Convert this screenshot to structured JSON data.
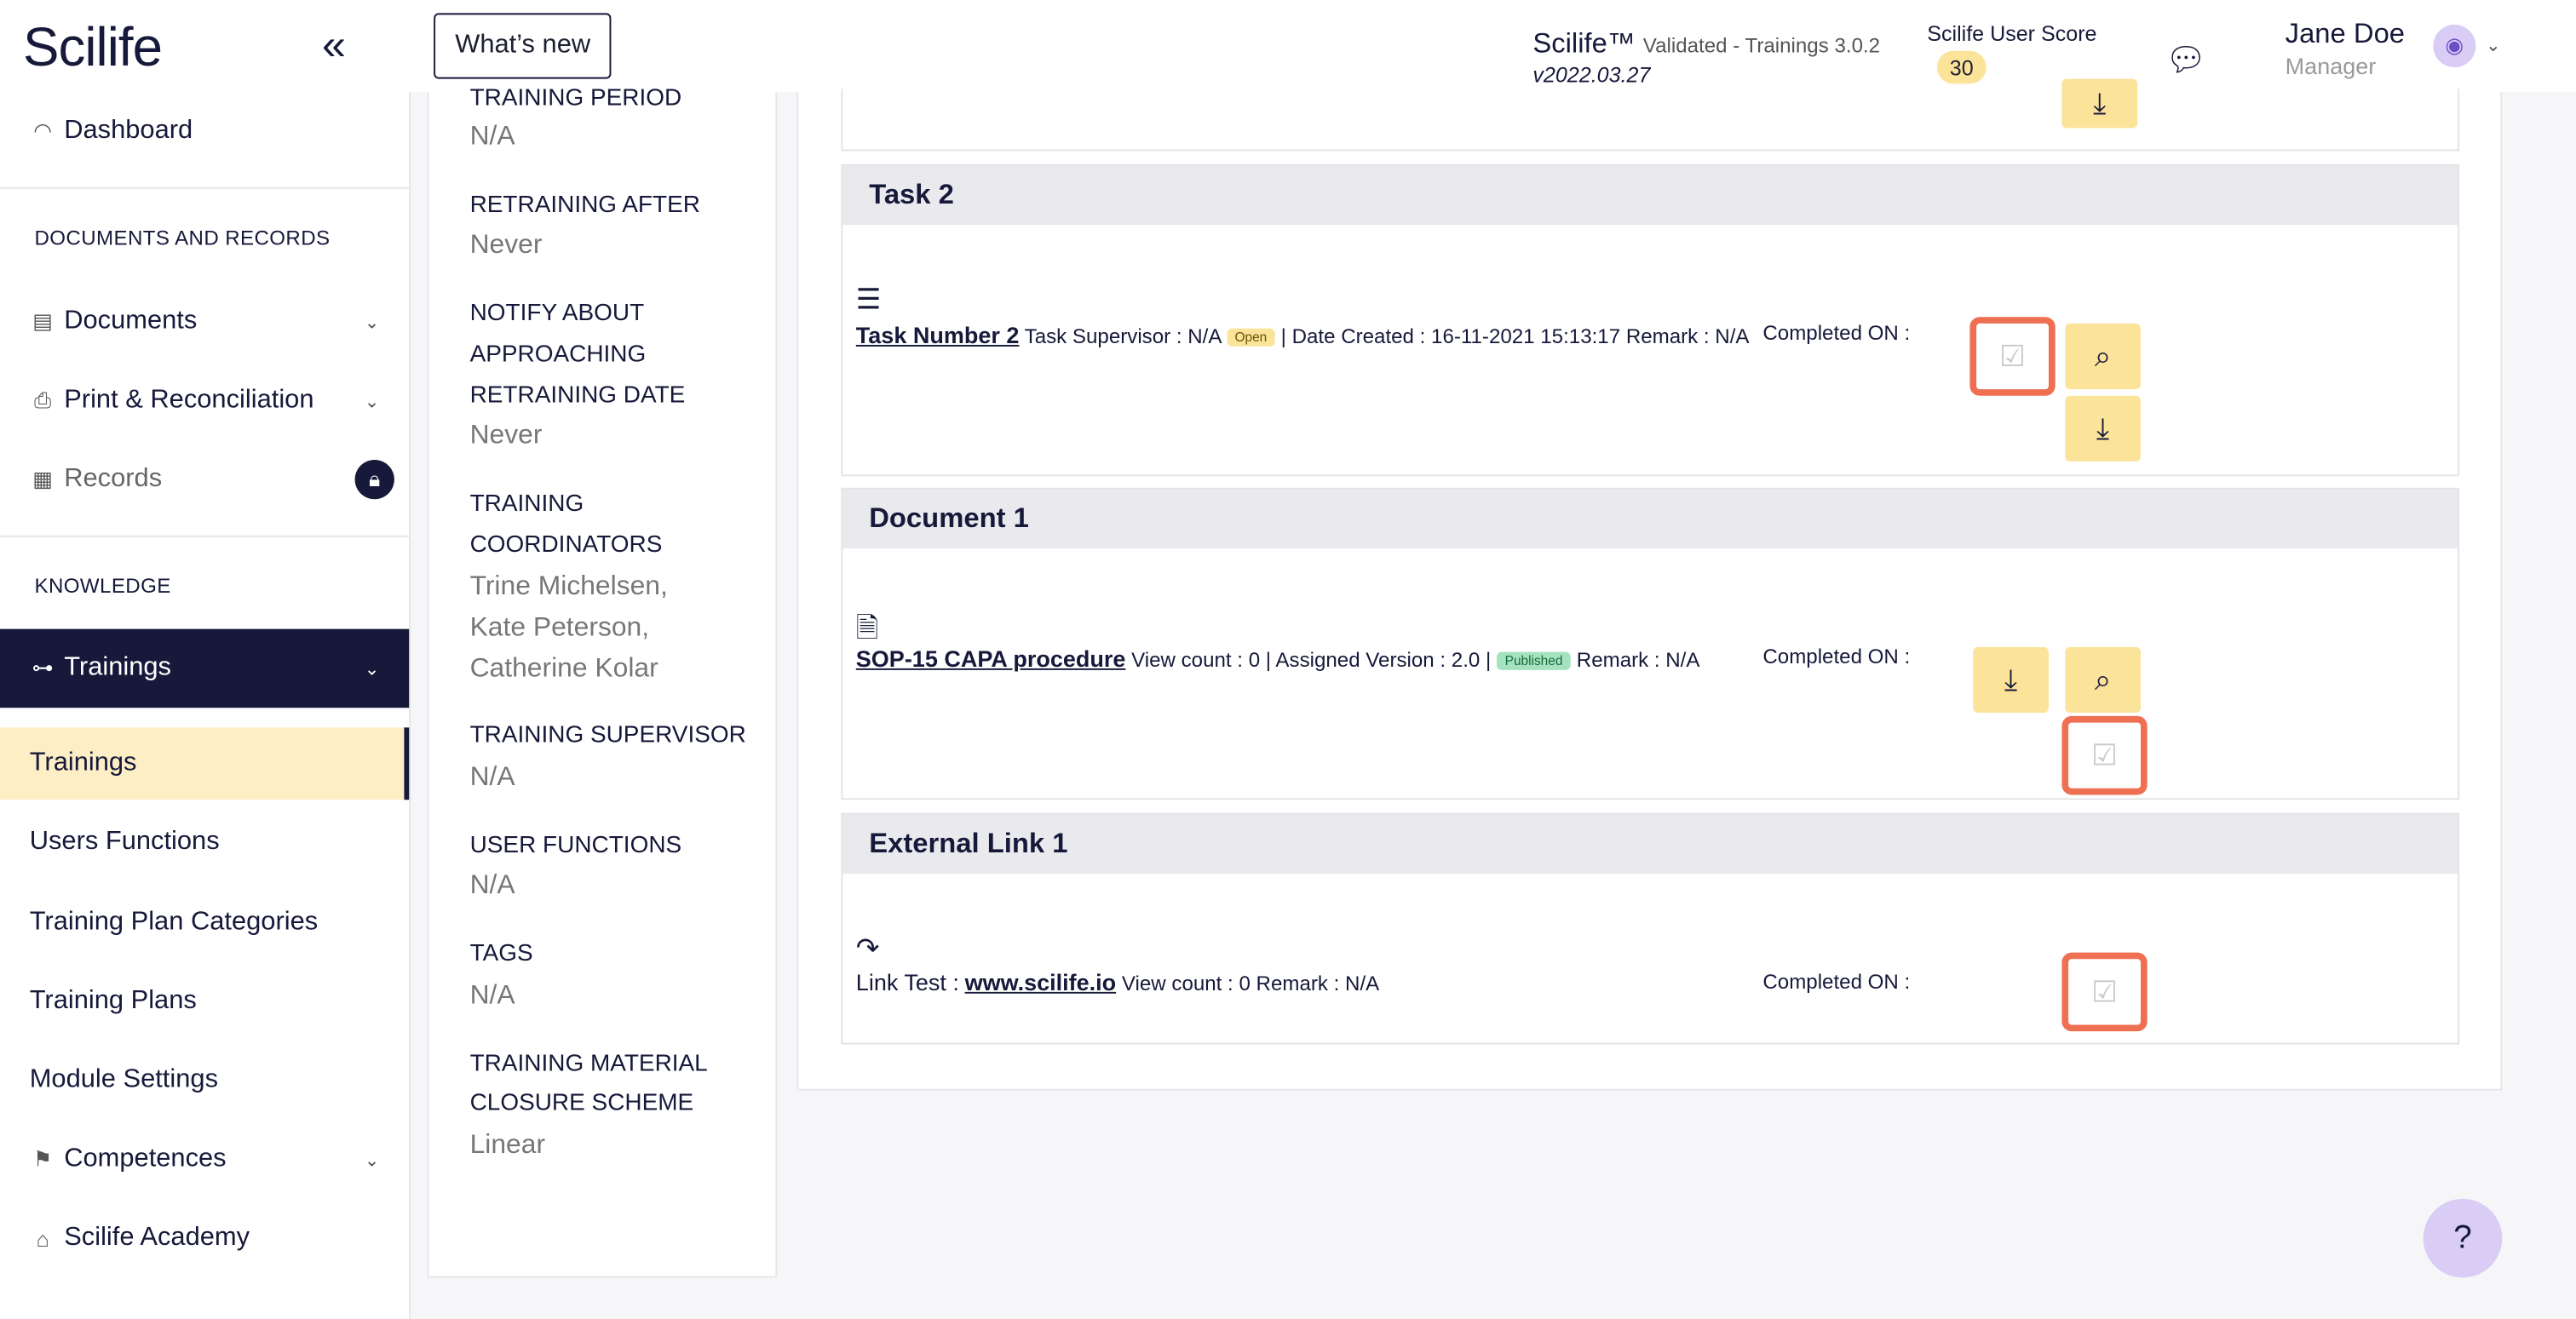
{
  "app": {
    "logo": "Scilife",
    "whats_new": "What’s new",
    "name": "Scilife™",
    "validated": "Validated - Trainings 3.0.2",
    "version": "v2022.03.27",
    "score_label": "Scilife User Score",
    "score": "30"
  },
  "user": {
    "name": "Jane Doe",
    "role": "Manager"
  },
  "sidebar": {
    "dashboard": "Dashboard",
    "section_docs": "DOCUMENTS AND RECORDS",
    "documents": "Documents",
    "print": "Print & Reconciliation",
    "records": "Records",
    "section_knowledge": "KNOWLEDGE",
    "trainings_group": "Trainings",
    "sub": [
      "Trainings",
      "Users Functions",
      "Training Plan Categories",
      "Training Plans",
      "Module Settings"
    ],
    "competences": "Competences",
    "academy": "Scilife Academy"
  },
  "detail": {
    "training_period_label": "TRAINING PERIOD",
    "training_period_value": "N/A",
    "retraining_label": "RETRAINING AFTER",
    "retraining_value": "Never",
    "notify_label_1": "NOTIFY ABOUT",
    "notify_label_2": "APPROACHING",
    "notify_label_3": "RETRAINING DATE",
    "notify_value": "Never",
    "coord_label_1": "TRAINING",
    "coord_label_2": "COORDINATORS",
    "coord_1": "Trine Michelsen,",
    "coord_2": "Kate Peterson,",
    "coord_3": "Catherine Kolar",
    "supervisor_label": "TRAINING SUPERVISOR",
    "supervisor_value": "N/A",
    "functions_label": "USER FUNCTIONS",
    "functions_value": "N/A",
    "tags_label": "TAGS",
    "tags_value": "N/A",
    "closure_label_1": "TRAINING MATERIAL",
    "closure_label_2": "CLOSURE SCHEME",
    "closure_value": "Linear"
  },
  "blocks": {
    "task": {
      "title": "Task 2",
      "link": "Task Number 2",
      "supervisor": "Task Supervisor : N/A",
      "status": "Open",
      "rest": "| Date Created : 16-11-2021 15:13:17 Remark : N/A",
      "completed": "Completed ON :"
    },
    "document": {
      "title": "Document 1",
      "link": "SOP-15 CAPA procedure",
      "meta": "View count : 0 | Assigned Version : 2.0 |",
      "status": "Published",
      "remark": "Remark : N/A",
      "completed": "Completed ON :"
    },
    "external": {
      "title": "External Link 1",
      "prefix": "Link Test :",
      "link": "www.scilife.io",
      "meta": "View count : 0 Remark : N/A",
      "completed": "Completed ON :"
    }
  },
  "colors": {
    "navy": "#17193a",
    "accent_yellow": "#fbe39a",
    "highlight": "#ee6f52"
  },
  "icons": [
    "speedometer-icon",
    "document-icon",
    "printer-icon",
    "records-icon",
    "lock-icon",
    "dumbbell-icon",
    "competences-icon",
    "graduation-cap-icon",
    "chat-icon",
    "list-icon",
    "file-link-icon",
    "share-arrow-icon",
    "search-icon",
    "download-icon",
    "checkbox-icon",
    "help-icon"
  ]
}
